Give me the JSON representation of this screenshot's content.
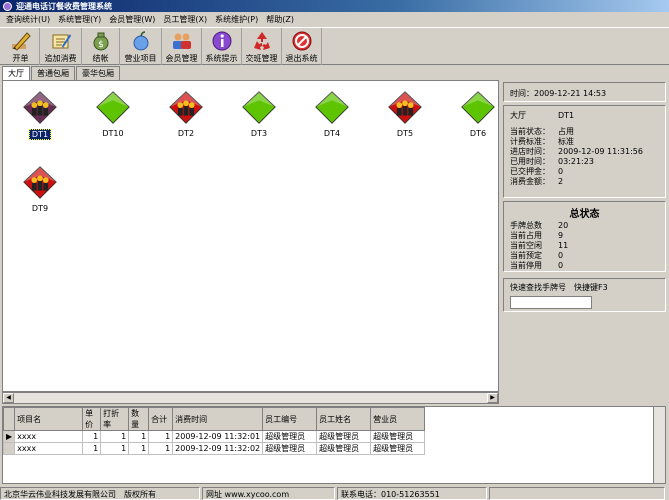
{
  "window": {
    "title": "迎通电话订餐收费管理系统"
  },
  "menu": [
    "查询统计(U)",
    "系统管理(Y)",
    "会员管理(W)",
    "员工管理(X)",
    "系统维护(P)",
    "帮助(Z)"
  ],
  "toolbar": [
    {
      "label": "开单",
      "icon": "pencil-icon"
    },
    {
      "label": "追加消费",
      "icon": "order-icon"
    },
    {
      "label": "结帐",
      "icon": "money-bag-icon"
    },
    {
      "label": "营业项目",
      "icon": "apple-icon"
    },
    {
      "label": "会员管理",
      "icon": "members-icon"
    },
    {
      "label": "系统提示",
      "icon": "info-icon"
    },
    {
      "label": "交班管理",
      "icon": "recycle-icon"
    },
    {
      "label": "退出系统",
      "icon": "exit-icon"
    }
  ],
  "tabs": [
    "大厅",
    "普通包厢",
    "豪华包厢"
  ],
  "rooms": [
    {
      "name": "DT1",
      "status": "occupied-selected"
    },
    {
      "name": "DT10",
      "status": "free"
    },
    {
      "name": "DT2",
      "status": "occupied"
    },
    {
      "name": "DT3",
      "status": "free"
    },
    {
      "name": "DT4",
      "status": "free"
    },
    {
      "name": "DT5",
      "status": "occupied"
    },
    {
      "name": "DT6",
      "status": "free"
    },
    {
      "name": "DT9",
      "status": "occupied"
    }
  ],
  "colors": {
    "free": "#5ec400",
    "occupied": "#cc1010",
    "selected": "#6a2c54",
    "accent": "#0a246a"
  },
  "panel": {
    "time_label": "时间：",
    "time_value": "2009-12-21 14:53",
    "area": "大厅",
    "room": "DT1",
    "details": [
      {
        "k": "当前状态：",
        "v": "占用"
      },
      {
        "k": "计费标准：",
        "v": "标准"
      },
      {
        "k": "进店时间：",
        "v": "2009-12-09 11:31:56"
      },
      {
        "k": "已用时间：",
        "v": "03:21:23"
      },
      {
        "k": "已交押金：",
        "v": "0"
      },
      {
        "k": "消费金额：",
        "v": "2"
      }
    ],
    "status_title": "总状态",
    "status": [
      {
        "k": "手牌总数",
        "v": "20"
      },
      {
        "k": "当前占用",
        "v": "9"
      },
      {
        "k": "当前空闲",
        "v": "11"
      },
      {
        "k": "当前预定",
        "v": "0"
      },
      {
        "k": "当前停用",
        "v": "0"
      }
    ],
    "search_label": "快速查找手牌号　快捷键F3",
    "search_value": ""
  },
  "bill": {
    "columns": [
      "项目名",
      "单价",
      "打折率",
      "数量",
      "合计",
      "消费时间",
      "员工编号",
      "员工姓名",
      "营业员"
    ],
    "rows": [
      [
        "xxxx",
        "1",
        "1",
        "1",
        "1",
        "2009-12-09 11:32:01",
        "超级管理员",
        "超级管理员",
        "超级管理员"
      ],
      [
        "xxxx",
        "1",
        "1",
        "1",
        "1",
        "2009-12-09 11:32:02",
        "超级管理员",
        "超级管理员",
        "超级管理员"
      ]
    ]
  },
  "statusbar": {
    "company": "北京华云伟业科技发展有限公司　版权所有",
    "website": "网址 www.xycoo.com",
    "phone": "联系电话：010-51263551"
  }
}
